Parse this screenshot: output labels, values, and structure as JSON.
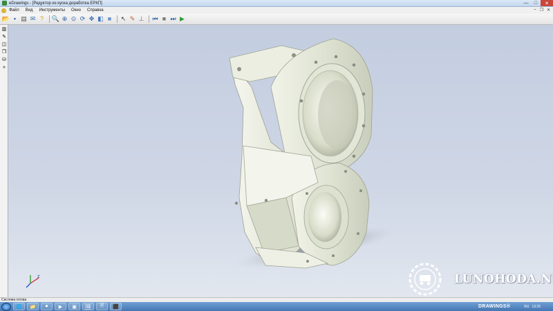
{
  "window": {
    "title": "eDrawings - [Редуктор из куска доработка ЕРКП]",
    "controls": {
      "minimize": "—",
      "maximize": "□",
      "close": "✕"
    }
  },
  "menubar": {
    "items": [
      "Файл",
      "Вид",
      "Инструменты",
      "Окно",
      "Справка"
    ],
    "doc_controls": {
      "minimize": "–",
      "restore": "❐",
      "close": "✕"
    }
  },
  "toolbar": {
    "buttons": [
      {
        "name": "open-icon",
        "glyph": "📂",
        "color": "#c9972c"
      },
      {
        "name": "save-icon",
        "glyph": "▪",
        "color": "#3460a8"
      },
      {
        "name": "print-icon",
        "glyph": "▤",
        "color": "#555555"
      },
      {
        "name": "email-icon",
        "glyph": "✉",
        "color": "#3a6fb0"
      },
      {
        "name": "help-icon",
        "glyph": "?",
        "color": "#d2a020"
      },
      {
        "name": "zoom-fit-icon",
        "glyph": "🔍",
        "color": "#2a5fa8"
      },
      {
        "name": "zoom-area-icon",
        "glyph": "⊕",
        "color": "#2a5fa8"
      },
      {
        "name": "zoom-icon",
        "glyph": "⊙",
        "color": "#2a5fa8"
      },
      {
        "name": "rotate-icon",
        "glyph": "⟳",
        "color": "#2a5fa8"
      },
      {
        "name": "pan-icon",
        "glyph": "✥",
        "color": "#2a5fa8"
      },
      {
        "name": "view-orientation-icon",
        "glyph": "◧",
        "color": "#3b73c0"
      },
      {
        "name": "shaded-icon",
        "glyph": "■",
        "color": "#6b90c9"
      },
      {
        "name": "select-icon",
        "glyph": "↖",
        "color": "#333333"
      },
      {
        "name": "markup-icon",
        "glyph": "✎",
        "color": "#c05a2a"
      },
      {
        "name": "measure-icon",
        "glyph": "⊥",
        "color": "#666666"
      },
      {
        "name": "first-frame-icon",
        "glyph": "⏮",
        "color": "#2a5fa8"
      },
      {
        "name": "stop-icon",
        "glyph": "■",
        "color": "#7a7a7a"
      },
      {
        "name": "next-frame-icon",
        "glyph": "⏭",
        "color": "#2a5fa8"
      },
      {
        "name": "play-icon",
        "glyph": "▶",
        "color": "#2f9e3a"
      }
    ]
  },
  "leftpanel": {
    "icons": [
      {
        "name": "components-icon",
        "glyph": "▥"
      },
      {
        "name": "markup-panel-icon",
        "glyph": "✎"
      },
      {
        "name": "section-icon",
        "glyph": "◫"
      },
      {
        "name": "explode-icon",
        "glyph": "❐"
      },
      {
        "name": "mass-icon",
        "glyph": "⛁"
      },
      {
        "name": "expand-icon",
        "glyph": "»"
      }
    ]
  },
  "watermark": {
    "text": "LUNOHODA.NET"
  },
  "statusbar": {
    "text": "Система готова"
  },
  "taskbar": {
    "tasks": [
      "🌐",
      "📁",
      "⏺",
      "▶",
      "▣",
      "🖼",
      "🗎",
      "⬛"
    ],
    "app_label": "DRAWINGS®",
    "lang": "RU",
    "clock": "13:25"
  },
  "colors": {
    "viewport_top": "#c3cde0",
    "part_body": "#e4e7d9",
    "part_shadow": "#a7ab9a"
  }
}
